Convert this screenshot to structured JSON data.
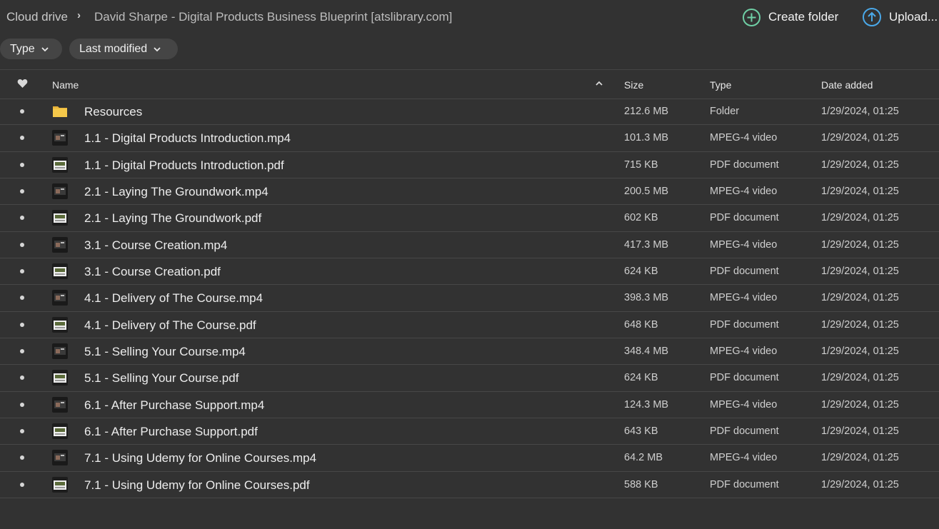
{
  "breadcrumb": {
    "root": "Cloud drive",
    "separator": "›",
    "current": "David Sharpe - Digital Products Business Blueprint [atslibrary.com]"
  },
  "actions": {
    "create_folder": "Create folder",
    "upload": "Upload..."
  },
  "filters": {
    "type": "Type",
    "last_modified": "Last modified"
  },
  "table": {
    "headers": {
      "name": "Name",
      "size": "Size",
      "type": "Type",
      "date_added": "Date added"
    },
    "rows": [
      {
        "name": "Resources",
        "size": "212.6 MB",
        "type": "Folder",
        "date": "1/29/2024, 01:25",
        "icon": "folder-icon"
      },
      {
        "name": "1.1 - Digital Products Introduction.mp4",
        "size": "101.3 MB",
        "type": "MPEG-4 video",
        "date": "1/29/2024, 01:25",
        "icon": "video-thumbnail"
      },
      {
        "name": "1.1 - Digital Products Introduction.pdf",
        "size": "715 KB",
        "type": "PDF document",
        "date": "1/29/2024, 01:25",
        "icon": "pdf-thumbnail"
      },
      {
        "name": "2.1 - Laying The Groundwork.mp4",
        "size": "200.5 MB",
        "type": "MPEG-4 video",
        "date": "1/29/2024, 01:25",
        "icon": "video-thumbnail"
      },
      {
        "name": "2.1 - Laying The Groundwork.pdf",
        "size": "602 KB",
        "type": "PDF document",
        "date": "1/29/2024, 01:25",
        "icon": "pdf-thumbnail"
      },
      {
        "name": "3.1 - Course Creation.mp4",
        "size": "417.3 MB",
        "type": "MPEG-4 video",
        "date": "1/29/2024, 01:25",
        "icon": "video-thumbnail"
      },
      {
        "name": "3.1 - Course Creation.pdf",
        "size": "624 KB",
        "type": "PDF document",
        "date": "1/29/2024, 01:25",
        "icon": "pdf-thumbnail"
      },
      {
        "name": "4.1 - Delivery of The Course.mp4",
        "size": "398.3 MB",
        "type": "MPEG-4 video",
        "date": "1/29/2024, 01:25",
        "icon": "video-thumbnail"
      },
      {
        "name": "4.1 - Delivery of The Course.pdf",
        "size": "648 KB",
        "type": "PDF document",
        "date": "1/29/2024, 01:25",
        "icon": "pdf-thumbnail"
      },
      {
        "name": "5.1 - Selling Your Course.mp4",
        "size": "348.4 MB",
        "type": "MPEG-4 video",
        "date": "1/29/2024, 01:25",
        "icon": "video-thumbnail"
      },
      {
        "name": "5.1 - Selling Your Course.pdf",
        "size": "624 KB",
        "type": "PDF document",
        "date": "1/29/2024, 01:25",
        "icon": "pdf-thumbnail"
      },
      {
        "name": "6.1 - After Purchase Support.mp4",
        "size": "124.3 MB",
        "type": "MPEG-4 video",
        "date": "1/29/2024, 01:25",
        "icon": "video-thumbnail"
      },
      {
        "name": "6.1 - After Purchase Support.pdf",
        "size": "643 KB",
        "type": "PDF document",
        "date": "1/29/2024, 01:25",
        "icon": "pdf-thumbnail"
      },
      {
        "name": "7.1 - Using Udemy for Online Courses.mp4",
        "size": "64.2 MB",
        "type": "MPEG-4 video",
        "date": "1/29/2024, 01:25",
        "icon": "video-thumbnail"
      },
      {
        "name": "7.1 - Using Udemy for Online Courses.pdf",
        "size": "588 KB",
        "type": "PDF document",
        "date": "1/29/2024, 01:25",
        "icon": "pdf-thumbnail"
      }
    ]
  },
  "colors": {
    "background": "#323232",
    "chip": "#454545",
    "create_accent": "#6fcfa5",
    "upload_accent": "#4aa8e8",
    "folder": "#f5c84a"
  }
}
